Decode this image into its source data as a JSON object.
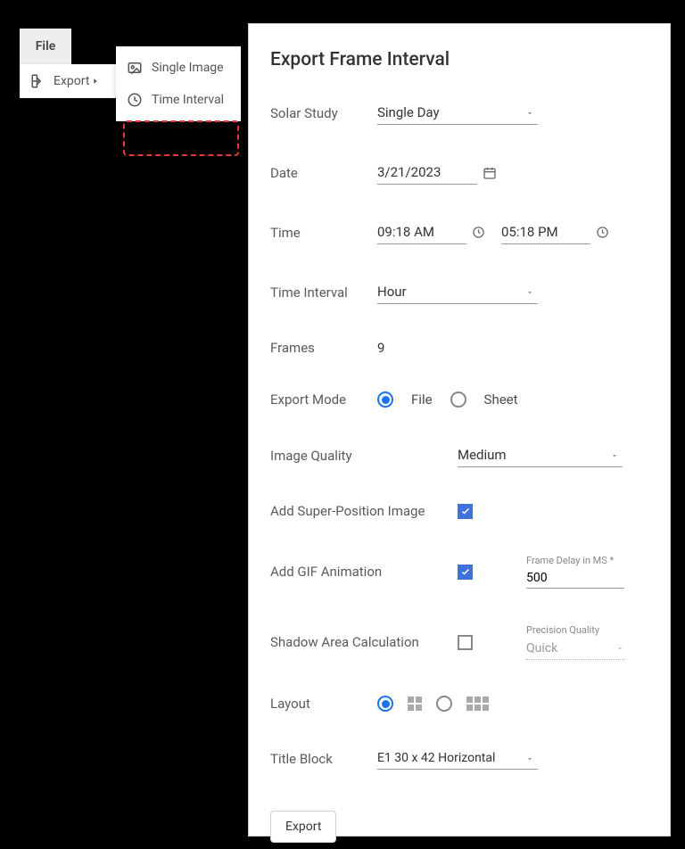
{
  "menu": {
    "file_label": "File",
    "export_label": "Export",
    "single_image_label": "Single Image",
    "time_interval_label": "Time Interval"
  },
  "dialog": {
    "title": "Export Frame Interval",
    "labels": {
      "solar_study": "Solar Study",
      "date": "Date",
      "time": "Time",
      "time_interval": "Time Interval",
      "frames": "Frames",
      "export_mode": "Export Mode",
      "image_quality": "Image Quality",
      "add_super_position": "Add Super-Position Image",
      "add_gif": "Add GIF Animation",
      "shadow_area": "Shadow Area Calculation",
      "layout": "Layout",
      "title_block": "Title Block",
      "frame_delay": "Frame Delay in MS *",
      "precision_quality_label": "Precision Quality"
    },
    "values": {
      "solar_study": "Single Day",
      "date": "3/21/2023",
      "time_start": "09:18 AM",
      "time_end": "05:18 PM",
      "time_interval": "Hour",
      "frames": "9",
      "export_mode_options": {
        "file": "File",
        "sheet": "Sheet"
      },
      "export_mode_selected": "file",
      "image_quality": "Medium",
      "add_super_position_checked": true,
      "add_gif_checked": true,
      "shadow_area_checked": false,
      "frame_delay_ms": "500",
      "precision_quality": "Quick",
      "layout_selected": "single",
      "title_block": "E1 30 x 42 Horizontal"
    },
    "export_button": "Export"
  }
}
